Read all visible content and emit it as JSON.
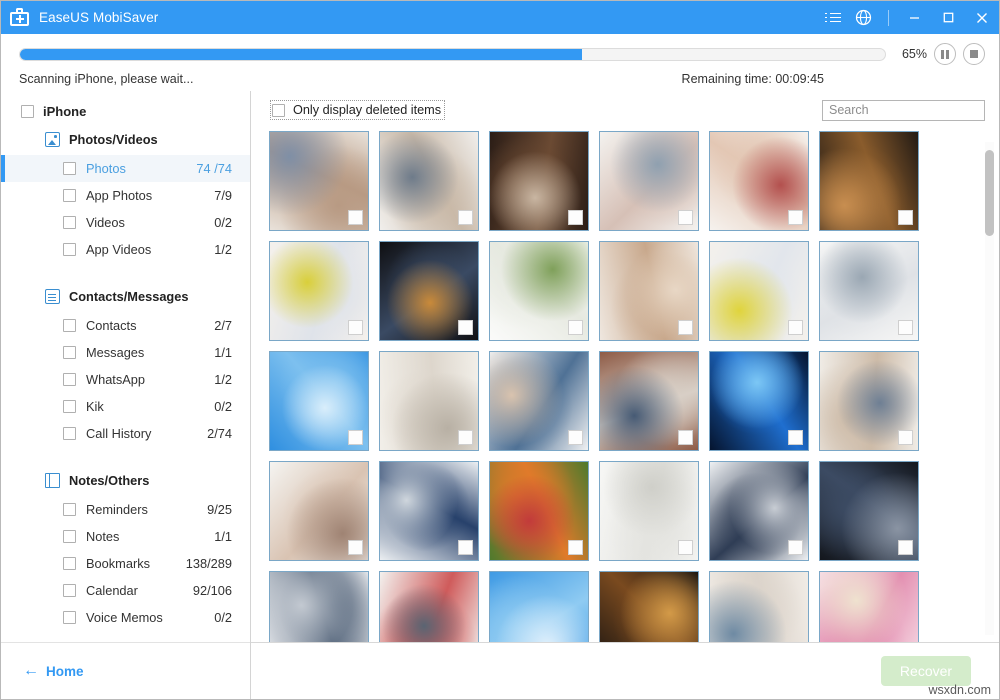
{
  "titlebar": {
    "app_name": "EaseUS MobiSaver",
    "icon": "first-aid-kit-icon",
    "menu_icon": "list-menu-icon",
    "globe_icon": "globe-icon",
    "minimize": "—",
    "maximize": "☐",
    "close": "✕",
    "accent_color": "#3399f3"
  },
  "progress": {
    "percent_label": "65%",
    "percent_value": 65,
    "status_text": "Scanning iPhone, please wait...",
    "remaining_text": "Remaining time: 00:09:45",
    "pause_icon": "pause-icon",
    "stop_icon": "stop-icon",
    "bar_color": "#3399f3"
  },
  "sidebar": {
    "root": {
      "label": "iPhone",
      "checked": false
    },
    "groups": [
      {
        "label": "Photos/Videos",
        "icon": "photo-icon",
        "items": [
          {
            "label": "Photos",
            "count": "74 /74",
            "active": true
          },
          {
            "label": "App Photos",
            "count": "7/9",
            "active": false
          },
          {
            "label": "Videos",
            "count": "0/2",
            "active": false
          },
          {
            "label": "App Videos",
            "count": "1/2",
            "active": false
          }
        ]
      },
      {
        "label": "Contacts/Messages",
        "icon": "clipboard-icon",
        "items": [
          {
            "label": "Contacts",
            "count": "2/7",
            "active": false
          },
          {
            "label": "Messages",
            "count": "1/1",
            "active": false
          },
          {
            "label": "WhatsApp",
            "count": "1/2",
            "active": false
          },
          {
            "label": "Kik",
            "count": "0/2",
            "active": false
          },
          {
            "label": "Call History",
            "count": "2/74",
            "active": false
          }
        ]
      },
      {
        "label": "Notes/Others",
        "icon": "notebook-icon",
        "items": [
          {
            "label": "Reminders",
            "count": "9/25",
            "active": false
          },
          {
            "label": "Notes",
            "count": "1/1",
            "active": false
          },
          {
            "label": "Bookmarks",
            "count": "138/289",
            "active": false
          },
          {
            "label": "Calendar",
            "count": "92/106",
            "active": false
          },
          {
            "label": "Voice Memos",
            "count": "0/2",
            "active": false
          }
        ]
      }
    ],
    "home": {
      "label": "Home",
      "arrow": "←",
      "icon": "back-arrow-icon"
    }
  },
  "main": {
    "only_deleted_label": "Only display deleted items",
    "only_deleted_checked": false,
    "search_placeholder": "Search",
    "search_value": "",
    "thumbnails": [
      {
        "id": 1,
        "desc": "family at laptop",
        "c1": "#e9e2da",
        "c2": "#b89a83",
        "c3": "#7f8fa6"
      },
      {
        "id": 2,
        "desc": "office desk pair",
        "c1": "#f1efec",
        "c2": "#c9b9a8",
        "c3": "#6e7b8a"
      },
      {
        "id": 3,
        "desc": "woman at night desk",
        "c1": "#2b1d16",
        "c2": "#6b4a33",
        "c3": "#c9b6a2"
      },
      {
        "id": 4,
        "desc": "man writing bright room",
        "c1": "#f4f2ef",
        "c2": "#d6c0b6",
        "c3": "#8fa0b0"
      },
      {
        "id": 5,
        "desc": "mother and child gift",
        "c1": "#f6f2ee",
        "c2": "#e3c7b4",
        "c3": "#b3504e"
      },
      {
        "id": 6,
        "desc": "woman phone dark cafe",
        "c1": "#221a14",
        "c2": "#8a5c2c",
        "c3": "#c88e50"
      },
      {
        "id": 7,
        "desc": "girl hugging grandmother",
        "c1": "#f5f1ec",
        "c2": "#dfe3ea",
        "c3": "#d9cf3a"
      },
      {
        "id": 8,
        "desc": "man laptop city night",
        "c1": "#0f0f12",
        "c2": "#3a4a63",
        "c3": "#c98a3a"
      },
      {
        "id": 9,
        "desc": "bright living room plant",
        "c1": "#fbfbfa",
        "c2": "#e6e9e0",
        "c3": "#7fa05a"
      },
      {
        "id": 10,
        "desc": "wooden table blur",
        "c1": "#efe7df",
        "c2": "#c8a88c",
        "c3": "#e8d7c5"
      },
      {
        "id": 11,
        "desc": "yellow tulips hug",
        "c1": "#f4f1ec",
        "c2": "#e2e6ec",
        "c3": "#e0d43c"
      },
      {
        "id": 12,
        "desc": "man laptop bookshelf",
        "c1": "#f7f7f6",
        "c2": "#dfe2e6",
        "c3": "#9aa7b3"
      },
      {
        "id": 13,
        "desc": "blue sky clouds",
        "c1": "#2f8fe0",
        "c2": "#7dc0ef",
        "c3": "#d9eefb"
      },
      {
        "id": 14,
        "desc": "white dining room",
        "c1": "#f2efe9",
        "c2": "#ddd6cc",
        "c3": "#b8b0a4"
      },
      {
        "id": 15,
        "desc": "man at laptop denim",
        "c1": "#f0f1f2",
        "c2": "#4f7195",
        "c3": "#d9c3ae"
      },
      {
        "id": 16,
        "desc": "team at brick office",
        "c1": "#8e5b46",
        "c2": "#d8cfc6",
        "c3": "#465a74"
      },
      {
        "id": 17,
        "desc": "earth globe blue space",
        "c1": "#05142e",
        "c2": "#1f6fd0",
        "c3": "#7cc7f5"
      },
      {
        "id": 18,
        "desc": "couple with laptop",
        "c1": "#f0ece6",
        "c2": "#cdbba8",
        "c3": "#6e7f94"
      },
      {
        "id": 19,
        "desc": "woman at desk window",
        "c1": "#f5f4f1",
        "c2": "#d9c3b2",
        "c3": "#9f8373"
      },
      {
        "id": 20,
        "desc": "team meeting screens",
        "c1": "#eceff2",
        "c2": "#27416b",
        "c3": "#cfd6dd"
      },
      {
        "id": 21,
        "desc": "woman colorful umbrella",
        "c1": "#4e7a2d",
        "c2": "#e07a2a",
        "c3": "#c23b3b"
      },
      {
        "id": 22,
        "desc": "white empty interior",
        "c1": "#f7f7f5",
        "c2": "#e4e4e0",
        "c3": "#cfcfc9"
      },
      {
        "id": 23,
        "desc": "handshake office",
        "c1": "#eef0f2",
        "c2": "#2f3d55",
        "c3": "#c8cdd4"
      },
      {
        "id": 24,
        "desc": "couple at laptop dark",
        "c1": "#13161c",
        "c2": "#3c4b63",
        "c3": "#8a94a3"
      },
      {
        "id": 25,
        "desc": "meeting table group",
        "c1": "#e9ebee",
        "c2": "#5b6b80",
        "c3": "#c3c9d1"
      },
      {
        "id": 26,
        "desc": "man bookshelf red",
        "c1": "#f3f1ee",
        "c2": "#cf5b5b",
        "c3": "#5a6472"
      },
      {
        "id": 27,
        "desc": "blue sky clouds 2",
        "c1": "#3f9ae4",
        "c2": "#8fcbf2",
        "c3": "#e2f1fc"
      },
      {
        "id": 28,
        "desc": "dark warm bar scene",
        "c1": "#1b1511",
        "c2": "#7a4a1f",
        "c3": "#d39a48"
      },
      {
        "id": 29,
        "desc": "couple flowers brick",
        "c1": "#f1ece6",
        "c2": "#dcd4cb",
        "c3": "#6e8aa3"
      },
      {
        "id": 30,
        "desc": "pink roses mothers day",
        "c1": "#f7dde6",
        "c2": "#e38fb1",
        "c3": "#efe2cf"
      }
    ]
  },
  "footer": {
    "recover_label": "Recover",
    "recover_enabled": false,
    "watermark": "wsxdn.com"
  }
}
